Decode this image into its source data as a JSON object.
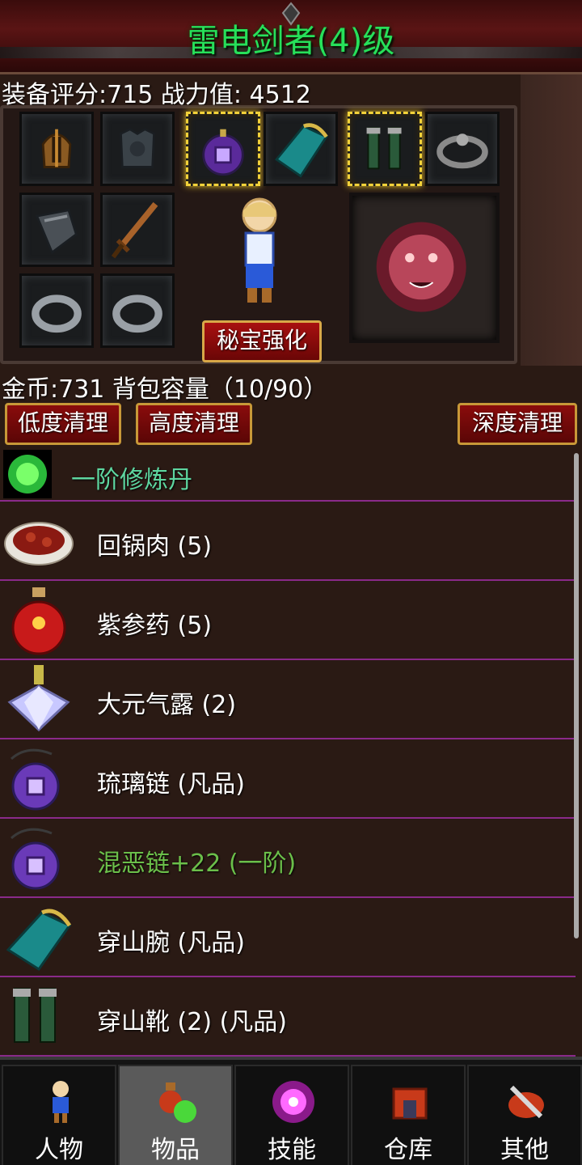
{
  "header": {
    "title": "雷电剑者(4)级",
    "stats": "装备评分:715 战力值:  4512"
  },
  "equipment": {
    "slots": [
      {
        "name": "helmet",
        "icon": "helmet-icon"
      },
      {
        "name": "armor",
        "icon": "armor-icon"
      },
      {
        "name": "necklace",
        "icon": "purple-amulet-icon",
        "highlight": true
      },
      {
        "name": "bracer",
        "icon": "bracer-icon"
      },
      {
        "name": "boots",
        "icon": "boots-icon",
        "highlight": true
      },
      {
        "name": "belt",
        "icon": "belt-icon"
      },
      {
        "name": "gauntlet",
        "icon": "gauntlet-icon"
      },
      {
        "name": "weapon",
        "icon": "sword-icon"
      },
      {
        "name": "ring-left",
        "icon": "ring-icon"
      },
      {
        "name": "ring-right",
        "icon": "ring-icon"
      }
    ],
    "mount_icon": "tiger-icon",
    "mibao_label": "秘宝强化"
  },
  "inventory": {
    "gold_line": "金币:731 背包容量（10/90）",
    "buttons": {
      "low": "低度清理",
      "high": "高度清理",
      "deep": "深度清理"
    },
    "items": [
      {
        "name": "一阶修炼丹",
        "icon": "green-orb-icon",
        "quality": "cyan"
      },
      {
        "name": "回锅肉 (5)",
        "icon": "meat-dish-icon",
        "quality": "white"
      },
      {
        "name": "紫参药 (5)",
        "icon": "red-potion-icon",
        "quality": "white"
      },
      {
        "name": "大元气露 (2)",
        "icon": "crystal-flask-icon",
        "quality": "white"
      },
      {
        "name": "琉璃链 (凡品)",
        "icon": "purple-amulet-icon",
        "quality": "white"
      },
      {
        "name": "混恶链+22 (一阶)",
        "icon": "purple-amulet-icon",
        "quality": "green"
      },
      {
        "name": "穿山腕 (凡品)",
        "icon": "bracer-icon",
        "quality": "white"
      },
      {
        "name": "穿山靴 (2) (凡品)",
        "icon": "boots-icon",
        "quality": "white"
      }
    ]
  },
  "tabs": [
    {
      "label": "人物",
      "icon": "character-icon"
    },
    {
      "label": "物品",
      "icon": "potion-icon",
      "active": true
    },
    {
      "label": "技能",
      "icon": "skill-orb-icon"
    },
    {
      "label": "仓库",
      "icon": "warehouse-icon"
    },
    {
      "label": "其他",
      "icon": "other-icon"
    }
  ],
  "colors": {
    "title": "#27e05a",
    "quality_green": "#6bbf4a",
    "quality_cyan": "#5ed6a0",
    "divider": "#8a2a8a",
    "button_red": "#8a0c0c",
    "button_border": "#c89838"
  }
}
